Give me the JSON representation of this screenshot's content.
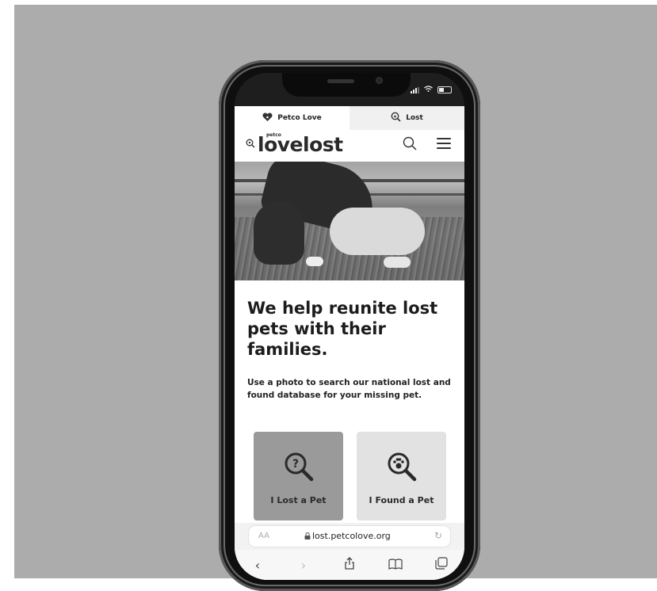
{
  "tabs": [
    {
      "label": "Petco Love",
      "icon": "heart-paw-icon"
    },
    {
      "label": "Lost",
      "icon": "search-paw-icon"
    }
  ],
  "brand": {
    "word": "lovelost",
    "petco": "petco"
  },
  "hero": {
    "alt": "girl hugging dog"
  },
  "headline": "We help reunite lost pets with their families.",
  "subtext": "Use a photo to search our national lost and found database for your missing pet.",
  "cards": [
    {
      "label": "I Lost a Pet",
      "icon": "question-magnifier-icon"
    },
    {
      "label": "I Found a Pet",
      "icon": "paw-magnifier-icon"
    }
  ],
  "browser": {
    "text_size": "AA",
    "url": "lost.petcolove.org"
  },
  "colors": {
    "lost_card": "#9a9a9a",
    "found_card": "#e2e2e2"
  }
}
